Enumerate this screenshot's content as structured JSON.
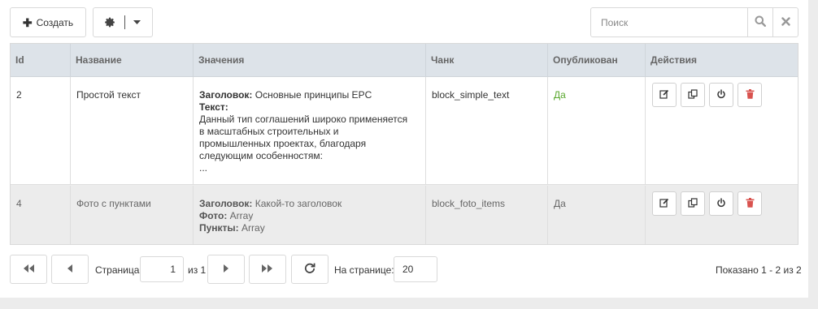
{
  "toolbar": {
    "create_label": "Создать",
    "search_placeholder": "Поиск",
    "search_value": ""
  },
  "grid": {
    "headers": [
      "Id",
      "Название",
      "Значения",
      "Чанк",
      "Опубликован",
      "Действия"
    ],
    "rows": [
      {
        "id": "2",
        "name": "Простой текст",
        "values": [
          {
            "label": "Заголовок:",
            "text": " Основные принципы EPC"
          },
          {
            "label": "Текст:",
            "text": ""
          },
          {
            "label": "",
            "text": "Данный тип соглашений широко применяется"
          },
          {
            "label": "",
            "text": "в масштабных строительных и"
          },
          {
            "label": "",
            "text": "промышленных проектах, благодаря"
          },
          {
            "label": "",
            "text": "следующим особенностям:"
          },
          {
            "label": "",
            "text": "..."
          }
        ],
        "chunk": "block_simple_text",
        "published": "Да"
      },
      {
        "id": "4",
        "name": "Фото с пунктами",
        "values": [
          {
            "label": "Заголовок:",
            "text": " Какой-то заголовок"
          },
          {
            "label": "Фото:",
            "text": " Array"
          },
          {
            "label": "Пункты:",
            "text": " Array"
          }
        ],
        "chunk": "block_foto_items",
        "published": "Да"
      }
    ]
  },
  "pager": {
    "page_label": "Страница",
    "page_value": "1",
    "of_label": "из 1",
    "per_page_label": "На странице:",
    "per_page_value": "20",
    "shown_label": "Показано 1 - 2 из 2"
  },
  "colors": {
    "header_bg": "#dde3e9",
    "published_green": "#5aa82e",
    "delete_red": "#d9534f"
  }
}
